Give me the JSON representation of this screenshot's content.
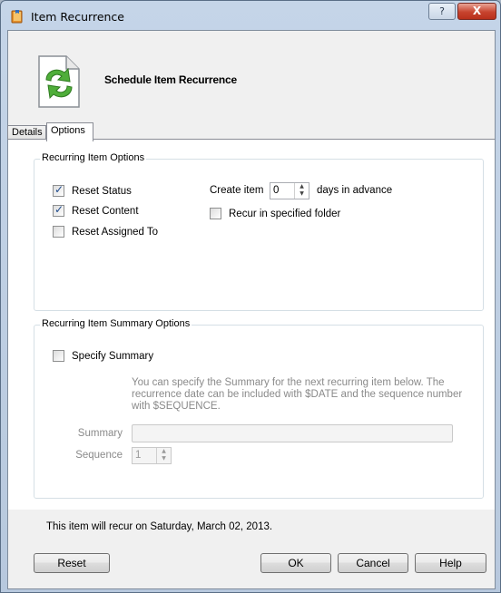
{
  "window": {
    "title": "Item Recurrence",
    "help_glyph": "?",
    "close_glyph": "X"
  },
  "header": {
    "title": "Schedule Item Recurrence"
  },
  "tabs": [
    {
      "label": "Details",
      "active": false
    },
    {
      "label": "Options",
      "active": true
    }
  ],
  "recurring_options": {
    "legend": "Recurring Item Options",
    "reset_status": {
      "label": "Reset Status",
      "checked": true
    },
    "reset_content": {
      "label": "Reset Content",
      "checked": true
    },
    "reset_assigned_to": {
      "label": "Reset Assigned To",
      "checked": false
    },
    "create_item_label": "Create item",
    "create_item_value": "0",
    "days_in_advance_label": "days in advance",
    "recur_in_folder": {
      "label": "Recur in specified folder",
      "checked": false
    }
  },
  "summary_options": {
    "legend": "Recurring Item Summary Options",
    "specify_summary": {
      "label": "Specify Summary",
      "checked": false
    },
    "description": "You can specify the Summary for the next recurring item below. The recurrence date can be included with $DATE and the sequence number with $SEQUENCE.",
    "summary_label": "Summary",
    "summary_value": "",
    "sequence_label": "Sequence",
    "sequence_value": "1"
  },
  "status": "This item will recur on Saturday, March 02, 2013.",
  "buttons": {
    "reset": "Reset",
    "ok": "OK",
    "cancel": "Cancel",
    "help": "Help"
  },
  "icons": {
    "app": "notebook-app-icon",
    "header": "document-recurrence-icon",
    "spinner_up": "▲",
    "spinner_down": "▼"
  }
}
